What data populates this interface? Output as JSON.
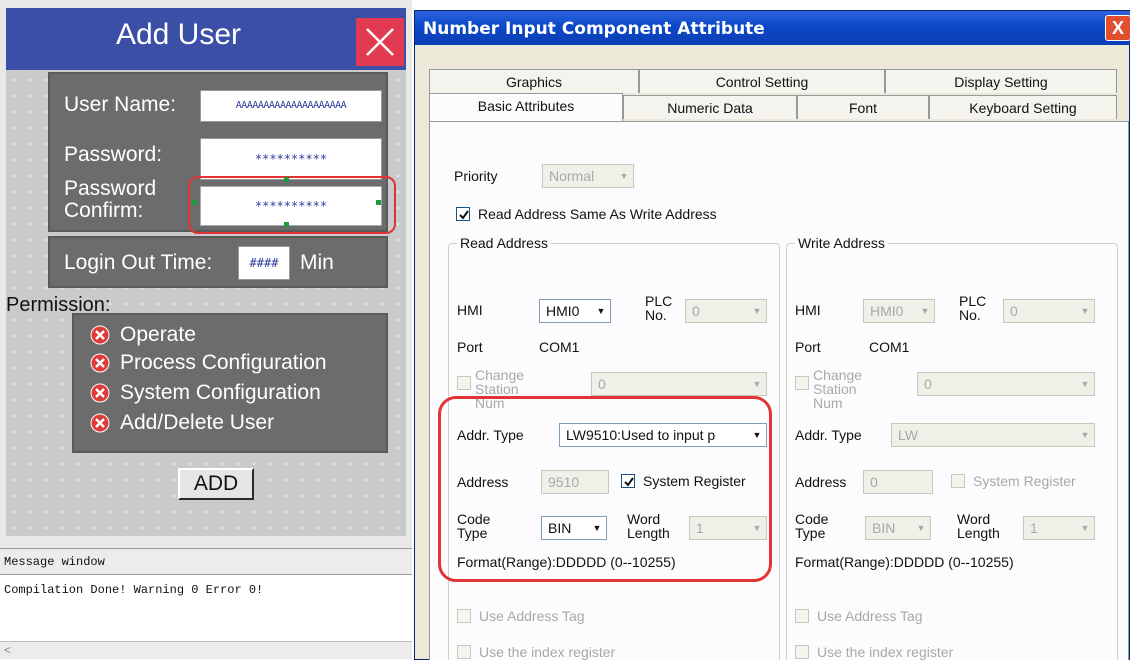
{
  "hmi": {
    "title": "Add User",
    "username_label": "User Name:",
    "username_value": "AAAAAAAAAAAAAAAAAAAA",
    "password_label": "Password:",
    "password_value": "**********",
    "confirm_label": "Password Confirm:",
    "confirm_value": "**********",
    "login_label": "Login Out Time:",
    "login_value": "####",
    "login_unit": "Min",
    "permission_label": "Permission:",
    "permissions": [
      "Operate",
      "Process Configuration",
      "System Configuration",
      "Add/Delete User"
    ],
    "add_button": "ADD"
  },
  "message_window": {
    "title": "Message window",
    "text": "Compilation Done! Warning 0 Error 0!",
    "scroll_glyph": "<"
  },
  "dialog": {
    "title": "Number Input Component Attribute",
    "close": "X",
    "tabs_back": [
      "Graphics",
      "Control Setting",
      "Display Setting"
    ],
    "tabs_front": [
      "Basic Attributes",
      "Numeric Data",
      "Font",
      "Keyboard Setting"
    ],
    "priority_label": "Priority",
    "priority_value": "Normal",
    "read_same_write": "Read Address Same As Write Address",
    "read": {
      "legend": "Read Address",
      "hmi_label": "HMI",
      "hmi_value": "HMI0",
      "plc_label": "PLC No.",
      "plc_value": "0",
      "port_label": "Port",
      "port_value": "COM1",
      "change_station": "Change Station Num",
      "station_value": "0",
      "addr_type_label": "Addr. Type",
      "addr_type_value": "LW9510:Used to input p",
      "address_label": "Address",
      "address_value": "9510",
      "system_register": "System Register",
      "code_type_label": "Code Type",
      "code_type_value": "BIN",
      "word_length_label": "Word Length",
      "word_length_value": "1",
      "format": "Format(Range):DDDDD (0--10255)",
      "use_address_tag": "Use Address Tag",
      "use_index_register": "Use the index register"
    },
    "write": {
      "legend": "Write Address",
      "hmi_label": "HMI",
      "hmi_value": "HMI0",
      "plc_label": "PLC No.",
      "plc_value": "0",
      "port_label": "Port",
      "port_value": "COM1",
      "change_station": "Change Station Num",
      "station_value": "0",
      "addr_type_label": "Addr. Type",
      "addr_type_value": "LW",
      "address_label": "Address",
      "address_value": "0",
      "system_register": "System Register",
      "code_type_label": "Code Type",
      "code_type_value": "BIN",
      "word_length_label": "Word Length",
      "word_length_value": "1",
      "format": "Format(Range):DDDDD (0--10255)",
      "use_address_tag": "Use Address Tag",
      "use_index_register": "Use the index register"
    }
  },
  "colors": {
    "hmi_title_bar": "#3c4fa6",
    "hmi_close": "#e23a50",
    "highlight": "#e23434",
    "dialog_title_bar": "#0a48c8"
  }
}
